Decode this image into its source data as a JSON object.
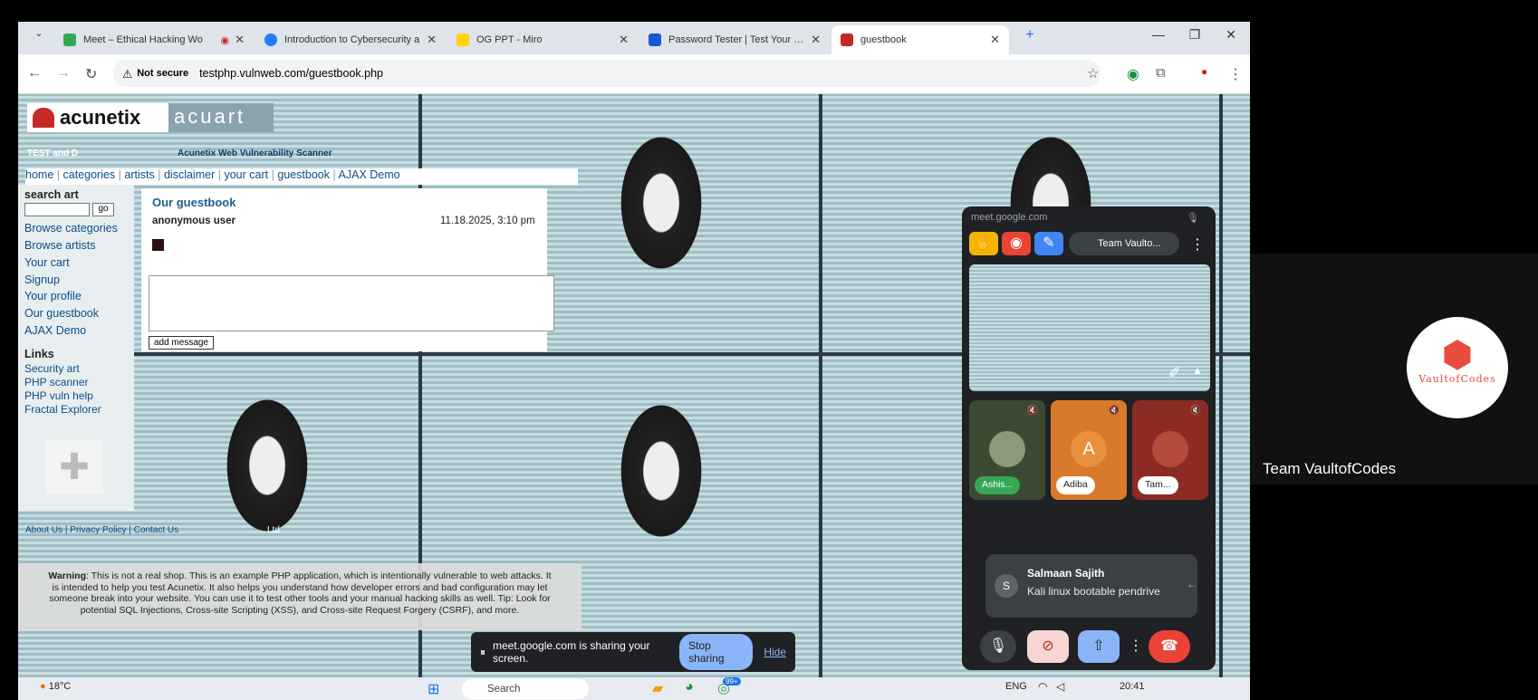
{
  "tabs": [
    {
      "title": "Meet – Ethical Hacking Wo",
      "color": "#34a853"
    },
    {
      "title": "Introduction to Cybersecurity a",
      "color": "#2979ff"
    },
    {
      "title": "OG PPT - Miro",
      "color": "#ffd400"
    },
    {
      "title": "Password Tester | Test Your Pas",
      "color": "#1a56db"
    },
    {
      "title": "guestbook",
      "color": "#c62828"
    }
  ],
  "address": {
    "security": "Not secure",
    "url": "testphp.vulnweb.com/guestbook.php"
  },
  "site": {
    "logo1": "acunetix",
    "logo2": "acuart",
    "tagline_left": "TEST and D",
    "tagline_right": "Acunetix Web Vulnerability Scanner",
    "topnav": [
      "home",
      "categories",
      "artists",
      "disclaimer",
      "your cart",
      "guestbook",
      "AJAX Demo"
    ],
    "search_label": "search art",
    "go": "go",
    "sidenav": [
      "Browse categories",
      "Browse artists",
      "Your cart",
      "Signup",
      "Your profile",
      "Our guestbook",
      "AJAX Demo"
    ],
    "links_heading": "Links",
    "links": [
      "Security art",
      "PHP scanner",
      "PHP vuln help",
      "Fractal Explorer"
    ],
    "footer": "About Us | Privacy Policy | Contact Us",
    "footer_tail": "Ltd",
    "guestbook_title": "Our guestbook",
    "entry_user": "anonymous user",
    "entry_date": "11.18.2025, 3:10 pm",
    "add_message": "add message",
    "warning_bold": "Warning",
    "warning_text": ": This is not a real shop. This is an example PHP application, which is intentionally vulnerable to web attacks. It is intended to help you test Acunetix. It also helps you understand how developer errors and bad configuration may let someone break into your website. You can use it to test other tools and your manual hacking skills as well. Tip: Look for potential SQL Injections, Cross-site Scripting (XSS), and Cross-site Request Forgery (CSRF), and more."
  },
  "share": {
    "text": "meet.google.com is sharing your screen.",
    "stop": "Stop sharing",
    "hide": "Hide"
  },
  "meet": {
    "url": "meet.google.com",
    "team_chip": "Team Vaulto...",
    "tiles": [
      {
        "label": "Ashis...",
        "num": "1",
        "color": "#4b5a3a",
        "initial": ""
      },
      {
        "label": "Adiba",
        "num": "2",
        "color": "#d77a2b",
        "initial": "A"
      },
      {
        "label": "Tam...",
        "num": "3",
        "color": "#8b2b24",
        "initial": ""
      }
    ],
    "chat_initial": "S",
    "chat_name": "Salmaan Sajith",
    "chat_msg": "Kali linux bootable pendrive"
  },
  "right": {
    "brand": "VaultofCodes",
    "name": "Team VaultofCodes"
  },
  "taskbar": {
    "temp": "18°C",
    "search": "Search",
    "badge": "99+",
    "lang": "ENG",
    "time": "20:41"
  }
}
